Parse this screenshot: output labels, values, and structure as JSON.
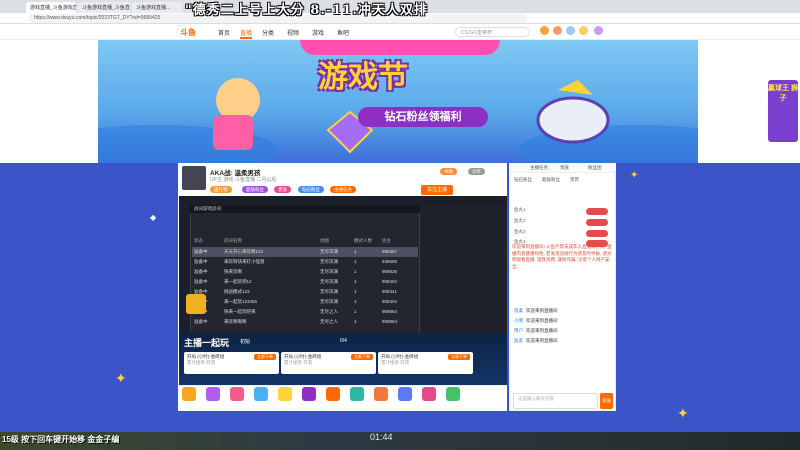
{
  "overlay_title": "\"德秀二上号上大分 8.-11.冲天人双排",
  "browser": {
    "tabs": [
      "游戏直播_斗鱼游戏直播_斗鱼直...",
      "斗鱼游戏直播_斗鱼直播_斗鱼...",
      "斗鱼游戏直播..."
    ],
    "url": "https://www.douyu.com/topic/2023TGT_DY?rid=9685425"
  },
  "site": {
    "logo": "斗鱼",
    "nav": [
      "首页",
      "直播",
      "分类",
      "视频",
      "游戏",
      "鱼吧"
    ],
    "search_placeholder": "CS:GO皇帝杯"
  },
  "banner": {
    "festival": "游戏节",
    "benefit": "钻石粉丝领福利",
    "right_ad": "赢球王 狮子"
  },
  "room": {
    "title": "AKA战: 温柔男孩",
    "meta": "UP主 游戏·斗鱼直播 二月以后",
    "follow": "关注主播",
    "report": "举报",
    "share": "分享",
    "pills": [
      "送礼物",
      "超级粉丝",
      "贵族",
      "钻石粉丝",
      "主播任务"
    ]
  },
  "game": {
    "window_title": "房间游戏房间",
    "headers": [
      "状态",
      "房间名称",
      "地图",
      "模式人数",
      "房主"
    ],
    "rows": [
      [
        "准备中",
        "天天开心来玩啊123",
        "无尽深渊",
        "1",
        "996357"
      ],
      [
        "准备中",
        "来玩呀快来打小怪兽",
        "无尽深渊",
        "1",
        "935605"
      ],
      [
        "准备中",
        "快来玩啊",
        "无尽深渊",
        "1",
        "908826"
      ],
      [
        "准备中",
        "来一起玩吧12",
        "无尽深渊",
        "1",
        "908404"
      ],
      [
        "准备中",
        "挑战模式123",
        "无尽深渊",
        "1",
        "908441"
      ],
      [
        "准备中",
        "来一起玩123456",
        "无尽深渊",
        "1",
        "908404"
      ],
      [
        "准备中",
        "快来一起玩吧来",
        "无尽之人",
        "1",
        "908864"
      ],
      [
        "准备中",
        "来玩啊啊啊",
        "无尽之人",
        "1",
        "908864"
      ]
    ]
  },
  "playtogether": {
    "title": "主播一起玩",
    "host": "初始",
    "count": "0/4",
    "cards": [
      {
        "title": "开局 (小时)-金砖组",
        "button": "立即下单",
        "desc": "累计接单 开黑"
      },
      {
        "title": "开局 (小时)-金砖组",
        "button": "立即下单",
        "desc": "累计接单 开黑"
      },
      {
        "title": "开局 (小时)-金砖组",
        "button": "立即下单",
        "desc": "累计接单 开黑"
      }
    ]
  },
  "chat": {
    "tabs": [
      "主播任务",
      "贵族",
      "粉丝团"
    ],
    "tabs2": [
      "钻石粉丝",
      "超级粉丝",
      "贵宾"
    ],
    "ranks": [
      "鱼丸1",
      "鱼丸2",
      "鱼丸3",
      "鱼丸4"
    ],
    "notice": "欢迎来到直播间! 斗鱼严禁未成年人直播或打赏, 直播内容健康绿色, 若发现违规行为请及时举报, 请文明观看直播, 理性消费, 谨防诈骗, 注意个人财产安全。",
    "messages": [
      {
        "user": "温柔",
        "text": "欢迎来到直播间"
      },
      {
        "user": "小明",
        "text": "欢迎来到直播间"
      },
      {
        "user": "用户",
        "text": "欢迎来到直播间"
      },
      {
        "user": "鱼友",
        "text": "欢迎来到直播间"
      }
    ],
    "input_placeholder": "这里输入聊天内容",
    "send": "发送"
  },
  "bottom": {
    "text": "15级 按下回车键开始移 金金子编",
    "number": "01:44"
  },
  "colors": {
    "accent": "#ff6a00",
    "banner": "#5aa8ea",
    "purple": "#8e2fc4"
  }
}
